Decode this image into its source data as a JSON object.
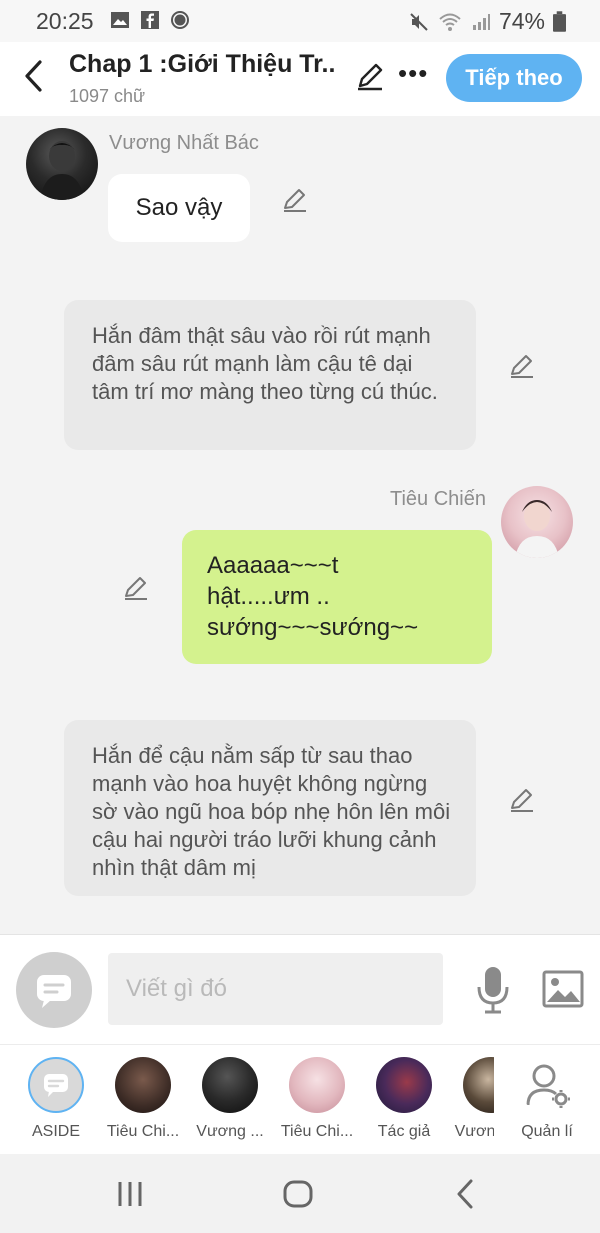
{
  "status_bar": {
    "time": "20:25",
    "battery": "74%",
    "icons_left": [
      "gallery-icon",
      "facebook-icon",
      "record-icon"
    ],
    "icons_right": [
      "mute-icon",
      "wifi-icon",
      "signal-icon",
      "battery-icon"
    ]
  },
  "header": {
    "title": "Chap 1 :Giới Thiệu Tr...",
    "word_count": "1097 chữ",
    "next_label": "Tiếp theo",
    "accent_color": "#5fb3f2"
  },
  "messages": [
    {
      "type": "character",
      "side": "left",
      "name": "Vương Nhất Bác",
      "text": "Sao vậy"
    },
    {
      "type": "narration",
      "text": "Hắn đâm thật sâu vào rồi rút mạnh đâm sâu rút mạnh làm cậu tê dại tâm trí mơ màng theo từng cú thúc."
    },
    {
      "type": "character",
      "side": "right",
      "name": "Tiêu Chiến",
      "text_lines": [
        "Aaaaaa~~~t",
        "hật.....ưm ..",
        "sướng~~~sướng~~"
      ],
      "bubble_color": "#d4f28e"
    },
    {
      "type": "narration",
      "text": "Hắn để cậu nằm sấp từ sau thao mạnh vào hoa huyệt không ngừng sờ vào ngũ hoa bóp nhẹ hôn lên môi cậu hai người tráo lưỡi khung cảnh nhìn thật dâm mị"
    }
  ],
  "composer": {
    "placeholder": "Viết gì đó"
  },
  "characters": [
    {
      "label": "ASIDE"
    },
    {
      "label": "Tiêu Chi..."
    },
    {
      "label": "Vương ..."
    },
    {
      "label": "Tiêu Chi..."
    },
    {
      "label": "Tác giả"
    },
    {
      "label": "Vươn"
    },
    {
      "label": "Quản lí"
    }
  ]
}
